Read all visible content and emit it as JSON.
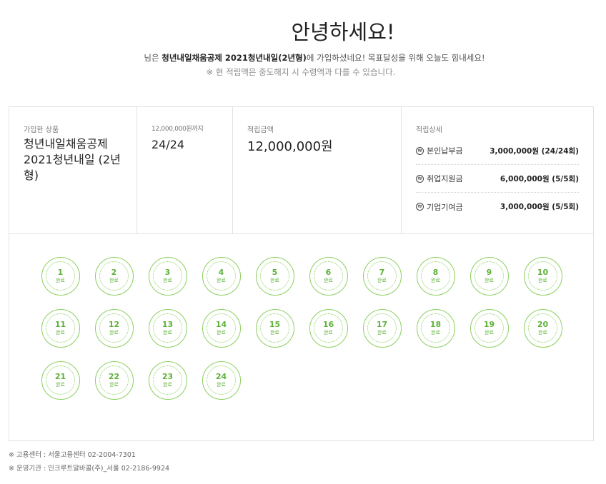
{
  "header": {
    "title": "안녕하세요!",
    "greet_prefix": "님은 ",
    "greet_product": "청년내일채움공제 2021청년내일(2년형)",
    "greet_suffix": "에 가입하셨네요! 목표달성을 위해 오늘도 힘내세요!",
    "notice": "※ 현 적립액은 중도해지 시 수령액과 다를 수 있습니다."
  },
  "info": {
    "product_label": "가입한 상품",
    "product_name": "청년내일채움공제 2021청년내일 (2년형)",
    "progress_label": "12,000,000원까지",
    "progress_value": "24/24",
    "amount_label": "적립금액",
    "amount_value": "12,000,000원",
    "detail_label": "적립상세",
    "details": [
      {
        "name": "본인납부금",
        "value": "3,000,000원 (24/24회)"
      },
      {
        "name": "취업지원금",
        "value": "6,000,000원 (5/5회)"
      },
      {
        "name": "기업기여금",
        "value": "3,000,000원 (5/5회)"
      }
    ],
    "detail_icon_glyph": "₩"
  },
  "stamps": {
    "done_label": "완료",
    "items": [
      "1",
      "2",
      "3",
      "4",
      "5",
      "6",
      "7",
      "8",
      "9",
      "10",
      "11",
      "12",
      "13",
      "14",
      "15",
      "16",
      "17",
      "18",
      "19",
      "20",
      "21",
      "22",
      "23",
      "24"
    ],
    "color": "#8bd05f"
  },
  "footer": {
    "line1": "※ 고용센터 : 서울고용센터 02-2004-7301",
    "line2": "※ 운영기관 : 인크루트알바콜(주)_서울 02-2186-9924"
  }
}
